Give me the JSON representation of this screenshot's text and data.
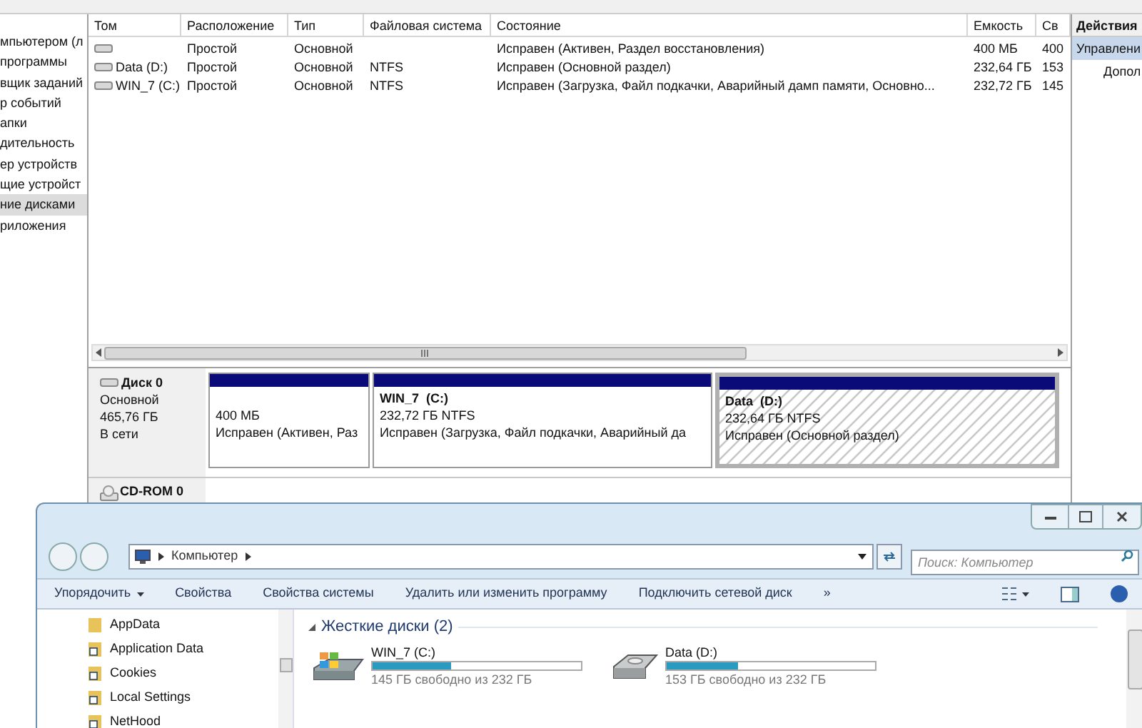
{
  "tree": {
    "items": [
      {
        "label": "мпьютером (л",
        "selected": false
      },
      {
        "label": "программы",
        "selected": false
      },
      {
        "label": "вщик заданий",
        "selected": false
      },
      {
        "label": "р событий",
        "selected": false
      },
      {
        "label": "апки",
        "selected": false
      },
      {
        "label": "дительность",
        "selected": false
      },
      {
        "label": "ер устройств",
        "selected": false
      },
      {
        "label": "щие устройст",
        "selected": false
      },
      {
        "label": "ние дисками",
        "selected": true
      },
      {
        "label": "риложения",
        "selected": false
      }
    ]
  },
  "volumes": {
    "columns": [
      "Том",
      "Расположение",
      "Тип",
      "Файловая система",
      "Состояние",
      "Емкость",
      "Св"
    ],
    "rows": [
      {
        "cells": [
          "",
          "Простой",
          "Основной",
          "",
          "Исправен (Активен, Раздел восстановления)",
          "400 МБ",
          "400"
        ]
      },
      {
        "cells": [
          "Data (D:)",
          "Простой",
          "Основной",
          "NTFS",
          "Исправен (Основной раздел)",
          "232,64 ГБ",
          "153"
        ]
      },
      {
        "cells": [
          "WIN_7 (C:)",
          "Простой",
          "Основной",
          "NTFS",
          "Исправен (Загрузка, Файл подкачки, Аварийный дамп памяти, Основно...",
          "232,72 ГБ",
          "145"
        ]
      }
    ]
  },
  "actions": {
    "title": "Действия",
    "items": [
      {
        "label": "Управлени",
        "selected": true
      },
      {
        "label": "Допол",
        "selected": false
      }
    ]
  },
  "disks": [
    {
      "kind": "disk",
      "name": "Диск 0",
      "type": "Основной",
      "size": "465,76 ГБ",
      "status": "В сети",
      "partitions": [
        {
          "size": "400 МБ",
          "status": "Исправен (Активен, Раз",
          "selected": false
        },
        {
          "title": "WIN_7  (C:)",
          "size": "232,72 ГБ NTFS",
          "status": "Исправен (Загрузка, Файл подкачки, Аварийный да",
          "selected": false
        },
        {
          "title": "Data  (D:)",
          "size": "232,64 ГБ NTFS",
          "status": "Исправен (Основной раздел)",
          "selected": true
        }
      ]
    },
    {
      "kind": "cdrom",
      "name": "CD-ROM 0"
    }
  ],
  "explorer": {
    "address": {
      "path": [
        "Компьютер"
      ]
    },
    "search": {
      "placeholder": "Поиск: Компьютер"
    },
    "toolbar": [
      {
        "label": "Упорядочить",
        "kind": "menu"
      },
      {
        "label": "Свойства",
        "kind": "button"
      },
      {
        "label": "Свойства системы",
        "kind": "button"
      },
      {
        "label": "Удалить или изменить программу",
        "kind": "button"
      },
      {
        "label": "Подключить сетевой диск",
        "kind": "button"
      },
      {
        "label": "»",
        "kind": "button"
      }
    ],
    "nav": [
      {
        "label": "AppData",
        "kind": "folder"
      },
      {
        "label": "Application Data",
        "kind": "shortcut"
      },
      {
        "label": "Cookies",
        "kind": "shortcut"
      },
      {
        "label": "Local Settings",
        "kind": "shortcut"
      },
      {
        "label": "NetHood",
        "kind": "shortcut"
      }
    ],
    "group": {
      "title": "Жесткие диски (2)",
      "expanded": true
    },
    "drives": [
      {
        "kind": "system",
        "name": "WIN_7 (C:)",
        "free": "145 ГБ свободно из 232 ГБ",
        "level": 0.375
      },
      {
        "kind": "disk",
        "name": "Data (D:)",
        "free": "153 ГБ свободно из 232 ГБ",
        "level": 0.34
      }
    ]
  }
}
